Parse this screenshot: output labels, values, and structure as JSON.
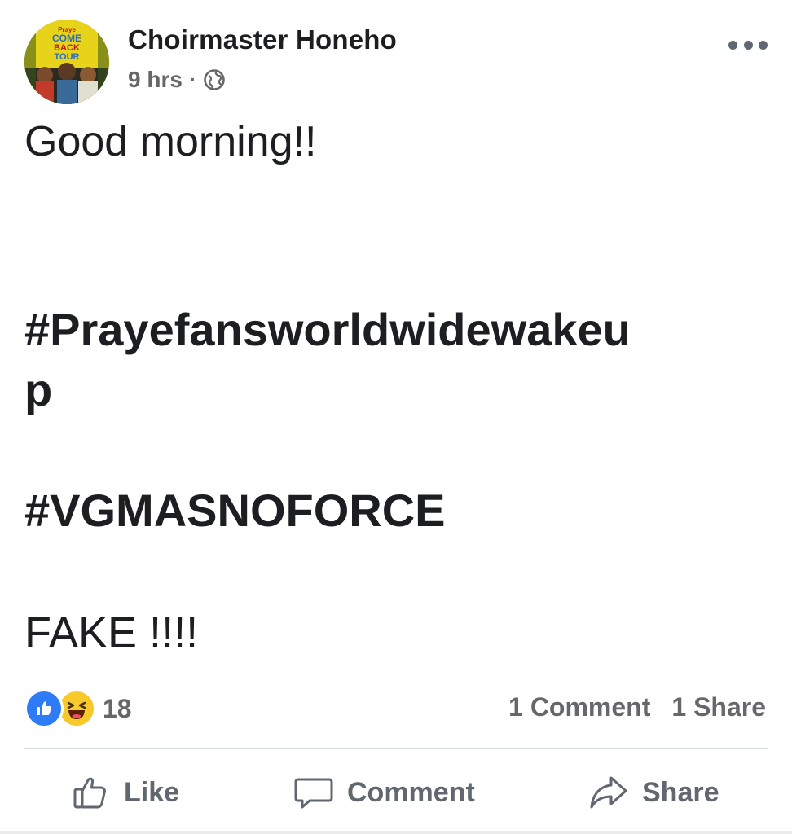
{
  "post": {
    "author": "Choirmaster Honeho",
    "time": "9 hrs",
    "separator": "·",
    "privacy_icon": "globe-icon",
    "more_icon": "more-options-icon",
    "avatar_text": {
      "line1": "Praye",
      "line2": "COME",
      "line3": "BACK",
      "line4": "TOUR"
    },
    "body": {
      "greeting": "Good morning!!",
      "hashtag1_part1": "#Prayefansworldwidewakeu",
      "hashtag1_part2": "p",
      "hashtag2": "#VGMASNOFORCE",
      "closing": "FAKE !!!!"
    }
  },
  "engagement": {
    "reaction_icons": [
      "like-reaction-icon",
      "haha-reaction-icon"
    ],
    "reaction_count": "18",
    "comments": "1 Comment",
    "shares": "1 Share"
  },
  "actions": {
    "like": "Like",
    "comment": "Comment",
    "share": "Share"
  },
  "colors": {
    "text": "#1c1e21",
    "secondary": "#65676b",
    "like_blue": "#2e7bf6",
    "haha_yellow": "#f7c92a",
    "divider": "#dadde1"
  }
}
